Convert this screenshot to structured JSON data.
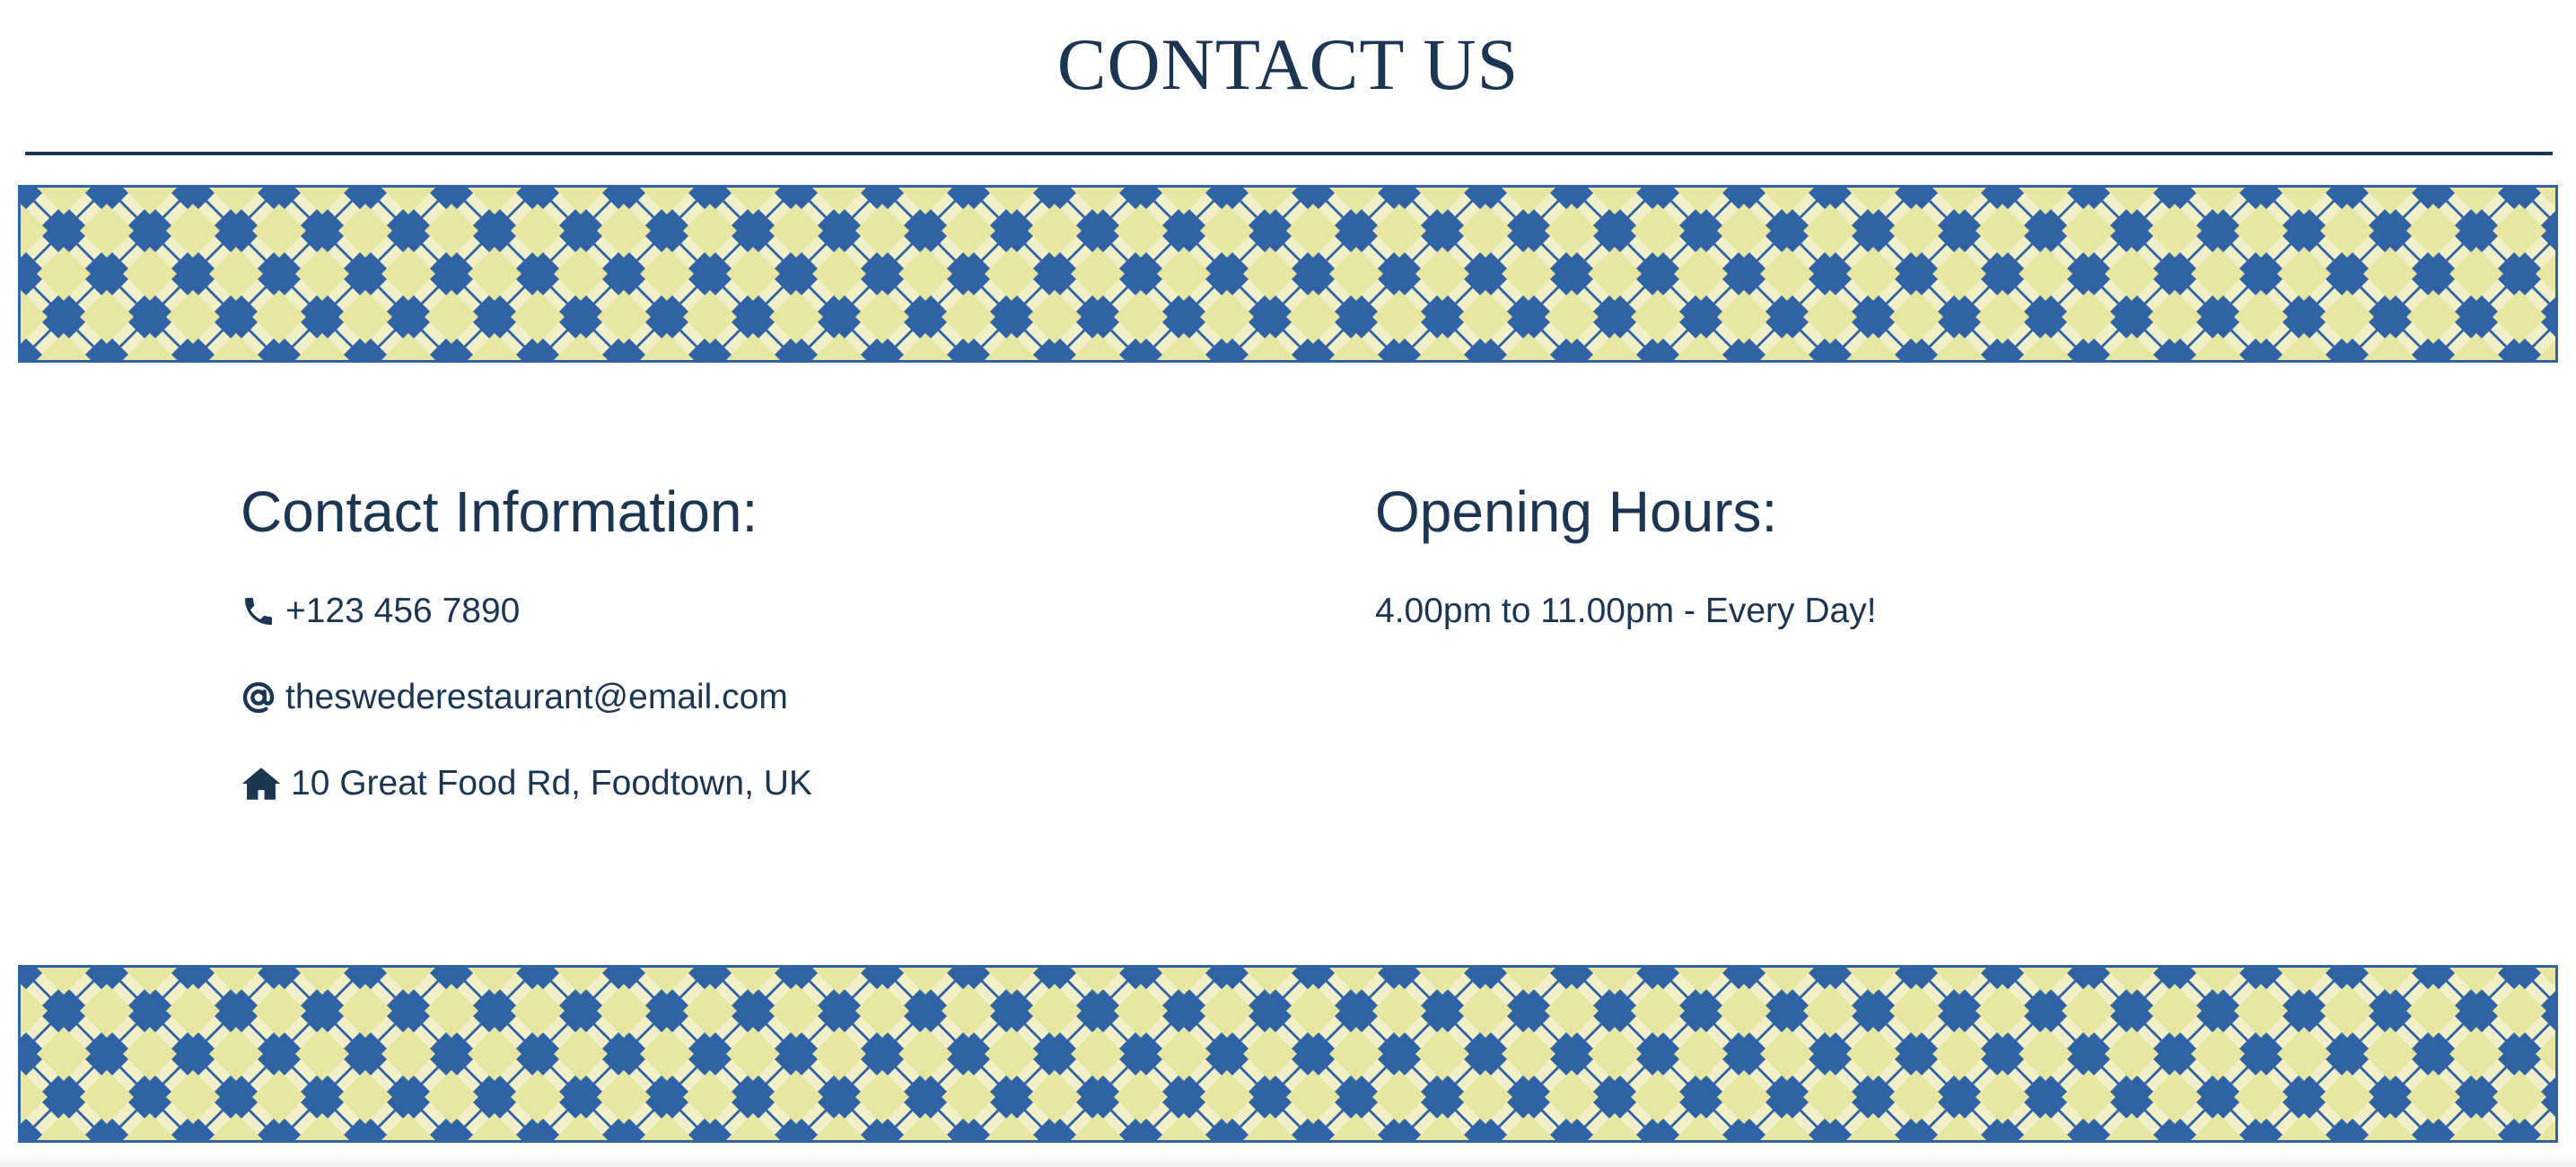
{
  "page": {
    "title": "CONTACT US"
  },
  "contact": {
    "heading": "Contact Information:",
    "phone": "+123 456 7890",
    "email": "theswederestaurant@email.com",
    "address": "10 Great Food Rd, Foodtown, UK",
    "icons": [
      "phone-icon",
      "at-sign-icon",
      "home-icon"
    ]
  },
  "hours": {
    "heading": "Opening Hours:",
    "text": "4.00pm to 11.00pm - Every Day!"
  },
  "colors": {
    "text": "#1b3553",
    "pattern_blue": "#2f63a4",
    "pattern_yellow": "#e7e7a3",
    "pattern_cream": "#f2f0c8"
  }
}
